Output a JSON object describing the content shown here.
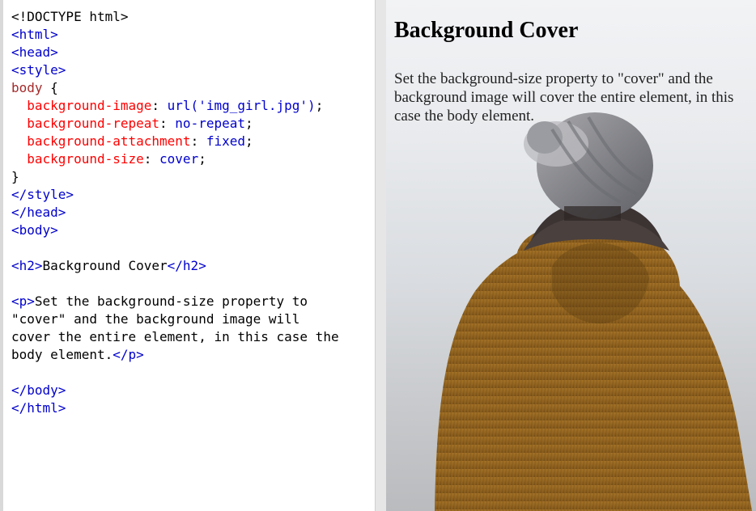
{
  "editor": {
    "lines": [
      [
        {
          "c": "plain",
          "t": "<!DOCTYPE html>"
        }
      ],
      [
        {
          "c": "tag",
          "t": "<html>"
        }
      ],
      [
        {
          "c": "tag",
          "t": "<head>"
        }
      ],
      [
        {
          "c": "tag",
          "t": "<style>"
        }
      ],
      [
        {
          "c": "sel",
          "t": "body"
        },
        {
          "c": "plain",
          "t": " {"
        }
      ],
      [
        {
          "c": "prop",
          "t": "  background-image"
        },
        {
          "c": "plain",
          "t": ": "
        },
        {
          "c": "val",
          "t": "url('img_girl.jpg')"
        },
        {
          "c": "plain",
          "t": ";"
        }
      ],
      [
        {
          "c": "prop",
          "t": "  background-repeat"
        },
        {
          "c": "plain",
          "t": ": "
        },
        {
          "c": "val",
          "t": "no-repeat"
        },
        {
          "c": "plain",
          "t": ";"
        }
      ],
      [
        {
          "c": "prop",
          "t": "  background-attachment"
        },
        {
          "c": "plain",
          "t": ": "
        },
        {
          "c": "val",
          "t": "fixed"
        },
        {
          "c": "plain",
          "t": ";"
        }
      ],
      [
        {
          "c": "prop",
          "t": "  background-size"
        },
        {
          "c": "plain",
          "t": ": "
        },
        {
          "c": "val",
          "t": "cover"
        },
        {
          "c": "plain",
          "t": ";"
        }
      ],
      [
        {
          "c": "plain",
          "t": "}"
        }
      ],
      [
        {
          "c": "tag",
          "t": "</style>"
        }
      ],
      [
        {
          "c": "tag",
          "t": "</head>"
        }
      ],
      [
        {
          "c": "tag",
          "t": "<body>"
        }
      ],
      [
        {
          "c": "plain",
          "t": ""
        }
      ],
      [
        {
          "c": "tag",
          "t": "<h2>"
        },
        {
          "c": "plain",
          "t": "Background Cover"
        },
        {
          "c": "tag",
          "t": "</h2>"
        }
      ],
      [
        {
          "c": "plain",
          "t": ""
        }
      ],
      [
        {
          "c": "tag",
          "t": "<p>"
        },
        {
          "c": "plain",
          "t": "Set the background-size property to"
        }
      ],
      [
        {
          "c": "plain",
          "t": "\"cover\" and the background image will"
        }
      ],
      [
        {
          "c": "plain",
          "t": "cover the entire element, in this case the"
        }
      ],
      [
        {
          "c": "plain",
          "t": "body element."
        },
        {
          "c": "tag",
          "t": "</p>"
        }
      ],
      [
        {
          "c": "plain",
          "t": ""
        }
      ],
      [
        {
          "c": "tag",
          "t": "</body>"
        }
      ],
      [
        {
          "c": "tag",
          "t": "</html>"
        }
      ]
    ]
  },
  "result": {
    "heading": "Background Cover",
    "paragraph": "Set the background-size property to \"cover\" and the background image will cover the entire element, in this case the body element."
  }
}
